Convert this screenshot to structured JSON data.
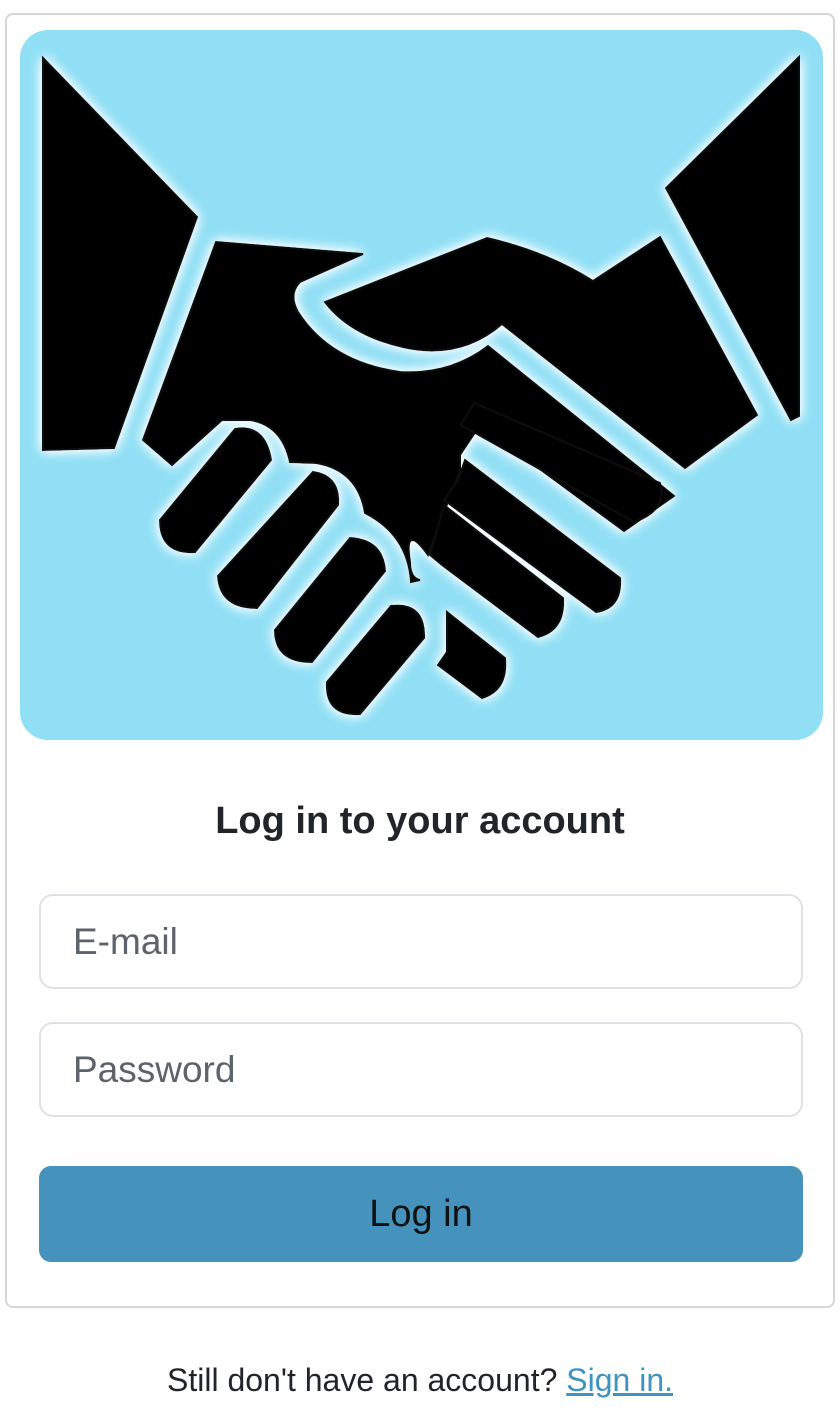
{
  "hero": {
    "image": "handshake-icon",
    "background": "#90dff5"
  },
  "form": {
    "title": "Log in to your account",
    "email_placeholder": "E-mail",
    "password_placeholder": "Password",
    "submit_label": "Log in",
    "button_color": "#4593bc"
  },
  "footer": {
    "prompt": "Still don't have an account?",
    "link_label": "Sign in.",
    "link_color": "#3f93c2"
  }
}
